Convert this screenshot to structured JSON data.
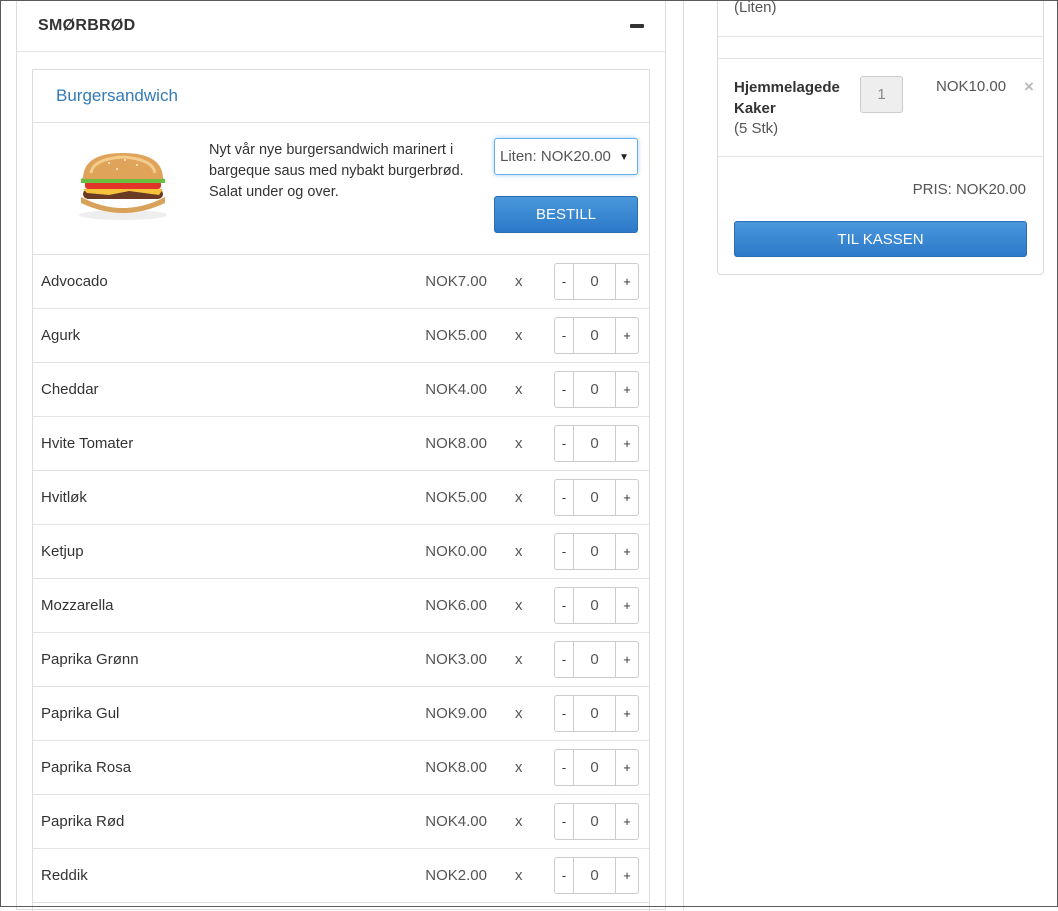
{
  "section": {
    "title": "SMØRBRØD"
  },
  "product": {
    "name": "Burgersandwich",
    "description": "Nyt vår nye burgersandwich marinert i bargeque saus med nybakt burgerbrød. Salat under og over.",
    "size_selected": "Liten: NOK20.00",
    "order_label": "BESTILL",
    "image_icon": "burger-image"
  },
  "toppings": [
    {
      "name": "Advocado",
      "price": "NOK7.00",
      "x": "x",
      "minus": "-",
      "qty": "0",
      "plus": "+"
    },
    {
      "name": "Agurk",
      "price": "NOK5.00",
      "x": "x",
      "minus": "-",
      "qty": "0",
      "plus": "+"
    },
    {
      "name": "Cheddar",
      "price": "NOK4.00",
      "x": "x",
      "minus": "-",
      "qty": "0",
      "plus": "+"
    },
    {
      "name": "Hvite Tomater",
      "price": "NOK8.00",
      "x": "x",
      "minus": "-",
      "qty": "0",
      "plus": "+"
    },
    {
      "name": "Hvitløk",
      "price": "NOK5.00",
      "x": "x",
      "minus": "-",
      "qty": "0",
      "plus": "+"
    },
    {
      "name": "Ketjup",
      "price": "NOK0.00",
      "x": "x",
      "minus": "-",
      "qty": "0",
      "plus": "+"
    },
    {
      "name": "Mozzarella",
      "price": "NOK6.00",
      "x": "x",
      "minus": "-",
      "qty": "0",
      "plus": "+"
    },
    {
      "name": "Paprika Grønn",
      "price": "NOK3.00",
      "x": "x",
      "minus": "-",
      "qty": "0",
      "plus": "+"
    },
    {
      "name": "Paprika Gul",
      "price": "NOK9.00",
      "x": "x",
      "minus": "-",
      "qty": "0",
      "plus": "+"
    },
    {
      "name": "Paprika Rosa",
      "price": "NOK8.00",
      "x": "x",
      "minus": "-",
      "qty": "0",
      "plus": "+"
    },
    {
      "name": "Paprika Rød",
      "price": "NOK4.00",
      "x": "x",
      "minus": "-",
      "qty": "0",
      "plus": "+"
    },
    {
      "name": "Reddik",
      "price": "NOK2.00",
      "x": "x",
      "minus": "-",
      "qty": "0",
      "plus": "+"
    }
  ],
  "cart": {
    "prev_item_sub": "(Liten)",
    "item": {
      "name": "Hjemmelagede Kaker",
      "sub": "(5 Stk)",
      "qty": "1",
      "price": "NOK10.00",
      "remove": "×"
    },
    "total": "PRIS: NOK20.00",
    "checkout_label": "TIL KASSEN"
  },
  "colors": {
    "primary": "#2c7ac9",
    "link": "#337ab7",
    "border": "#dcdcdc"
  }
}
